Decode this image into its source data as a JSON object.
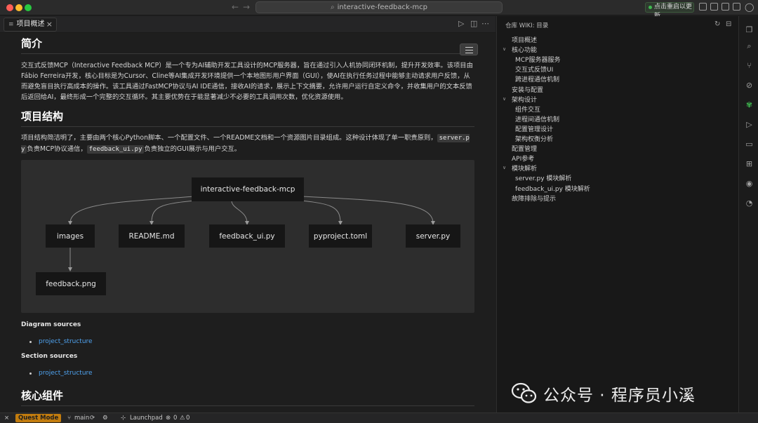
{
  "titlebar": {
    "search_text": "interactive-feedback-mcp",
    "update_button": "点击重启以更新"
  },
  "tab": {
    "label": "项目概述"
  },
  "doc": {
    "intro_heading": "简介",
    "intro_para": "交互式反馈MCP（Interactive Feedback MCP）是一个专为AI辅助开发工具设计的MCP服务器，旨在通过引入人机协同闭环机制，提升开发效率。该项目由Fábio Ferreira开发，核心目标是为Cursor、Cline等AI集成开发环境提供一个本地图形用户界面（GUI），使AI在执行任务过程中能够主动请求用户反馈，从而避免盲目执行高成本的操作。该工具通过FastMCP协议与AI IDE通信，接收AI的请求，展示上下文摘要，允许用户运行自定义命令，并收集用户的文本反馈后返回给AI，最终形成一个完整的交互循环。其主要优势在于能显著减少不必要的工具调用次数，优化资源使用。",
    "structure_heading": "项目结构",
    "structure_para_1": "项目结构简洁明了，主要由两个核心Python脚本、一个配置文件、一个README文档和一个资源图片目录组成。这种设计体现了单一职责原则，",
    "structure_code_1": "server.py",
    "structure_para_2": "负责MCP协议通信，",
    "structure_code_2": "feedback_ui.py",
    "structure_para_3": "负责独立的GUI展示与用户交互。",
    "diagram_sources_label": "Diagram sources",
    "diagram_source_link": "project_structure",
    "section_sources_label": "Section sources",
    "section_source_link": "project_structure",
    "core_heading": "核心组件"
  },
  "diagram": {
    "root": "interactive-feedback-mcp",
    "children": [
      "images",
      "README.md",
      "feedback_ui.py",
      "pyproject.toml",
      "server.py"
    ],
    "grandchild": "feedback.png"
  },
  "wiki": {
    "header": "仓库 WIKI: 目录",
    "items": [
      {
        "label": "项目概述",
        "level": 0,
        "chevron": false
      },
      {
        "label": "核心功能",
        "level": 0,
        "chevron": true
      },
      {
        "label": "MCP服务器服务",
        "level": 1,
        "chevron": false
      },
      {
        "label": "交互式反馈UI",
        "level": 1,
        "chevron": false
      },
      {
        "label": "跨进程通信机制",
        "level": 1,
        "chevron": false
      },
      {
        "label": "安装与配置",
        "level": 0,
        "chevron": false
      },
      {
        "label": "架构设计",
        "level": 0,
        "chevron": true
      },
      {
        "label": "组件交互",
        "level": 1,
        "chevron": false
      },
      {
        "label": "进程间通信机制",
        "level": 1,
        "chevron": false
      },
      {
        "label": "配置管理设计",
        "level": 1,
        "chevron": false
      },
      {
        "label": "架构权衡分析",
        "level": 1,
        "chevron": false
      },
      {
        "label": "配置管理",
        "level": 0,
        "chevron": false
      },
      {
        "label": "API参考",
        "level": 0,
        "chevron": false
      },
      {
        "label": "模块解析",
        "level": 0,
        "chevron": true
      },
      {
        "label": "server.py 模块解析",
        "level": 1,
        "chevron": false
      },
      {
        "label": "feedback_ui.py 模块解析",
        "level": 1,
        "chevron": false
      },
      {
        "label": "故障排除与提示",
        "level": 0,
        "chevron": false
      }
    ]
  },
  "statusbar": {
    "quest_mode": "Quest Mode",
    "branch": "main",
    "launchpad": "Launchpad",
    "errors": "0",
    "warnings": "0"
  },
  "watermark": {
    "text": "公众号 · 程序员小溪"
  },
  "colors": {
    "accent_link": "#4fa3f0",
    "quest": "#c27c0e",
    "update_dot": "#3fb950",
    "active_icon": "#3fb950"
  }
}
